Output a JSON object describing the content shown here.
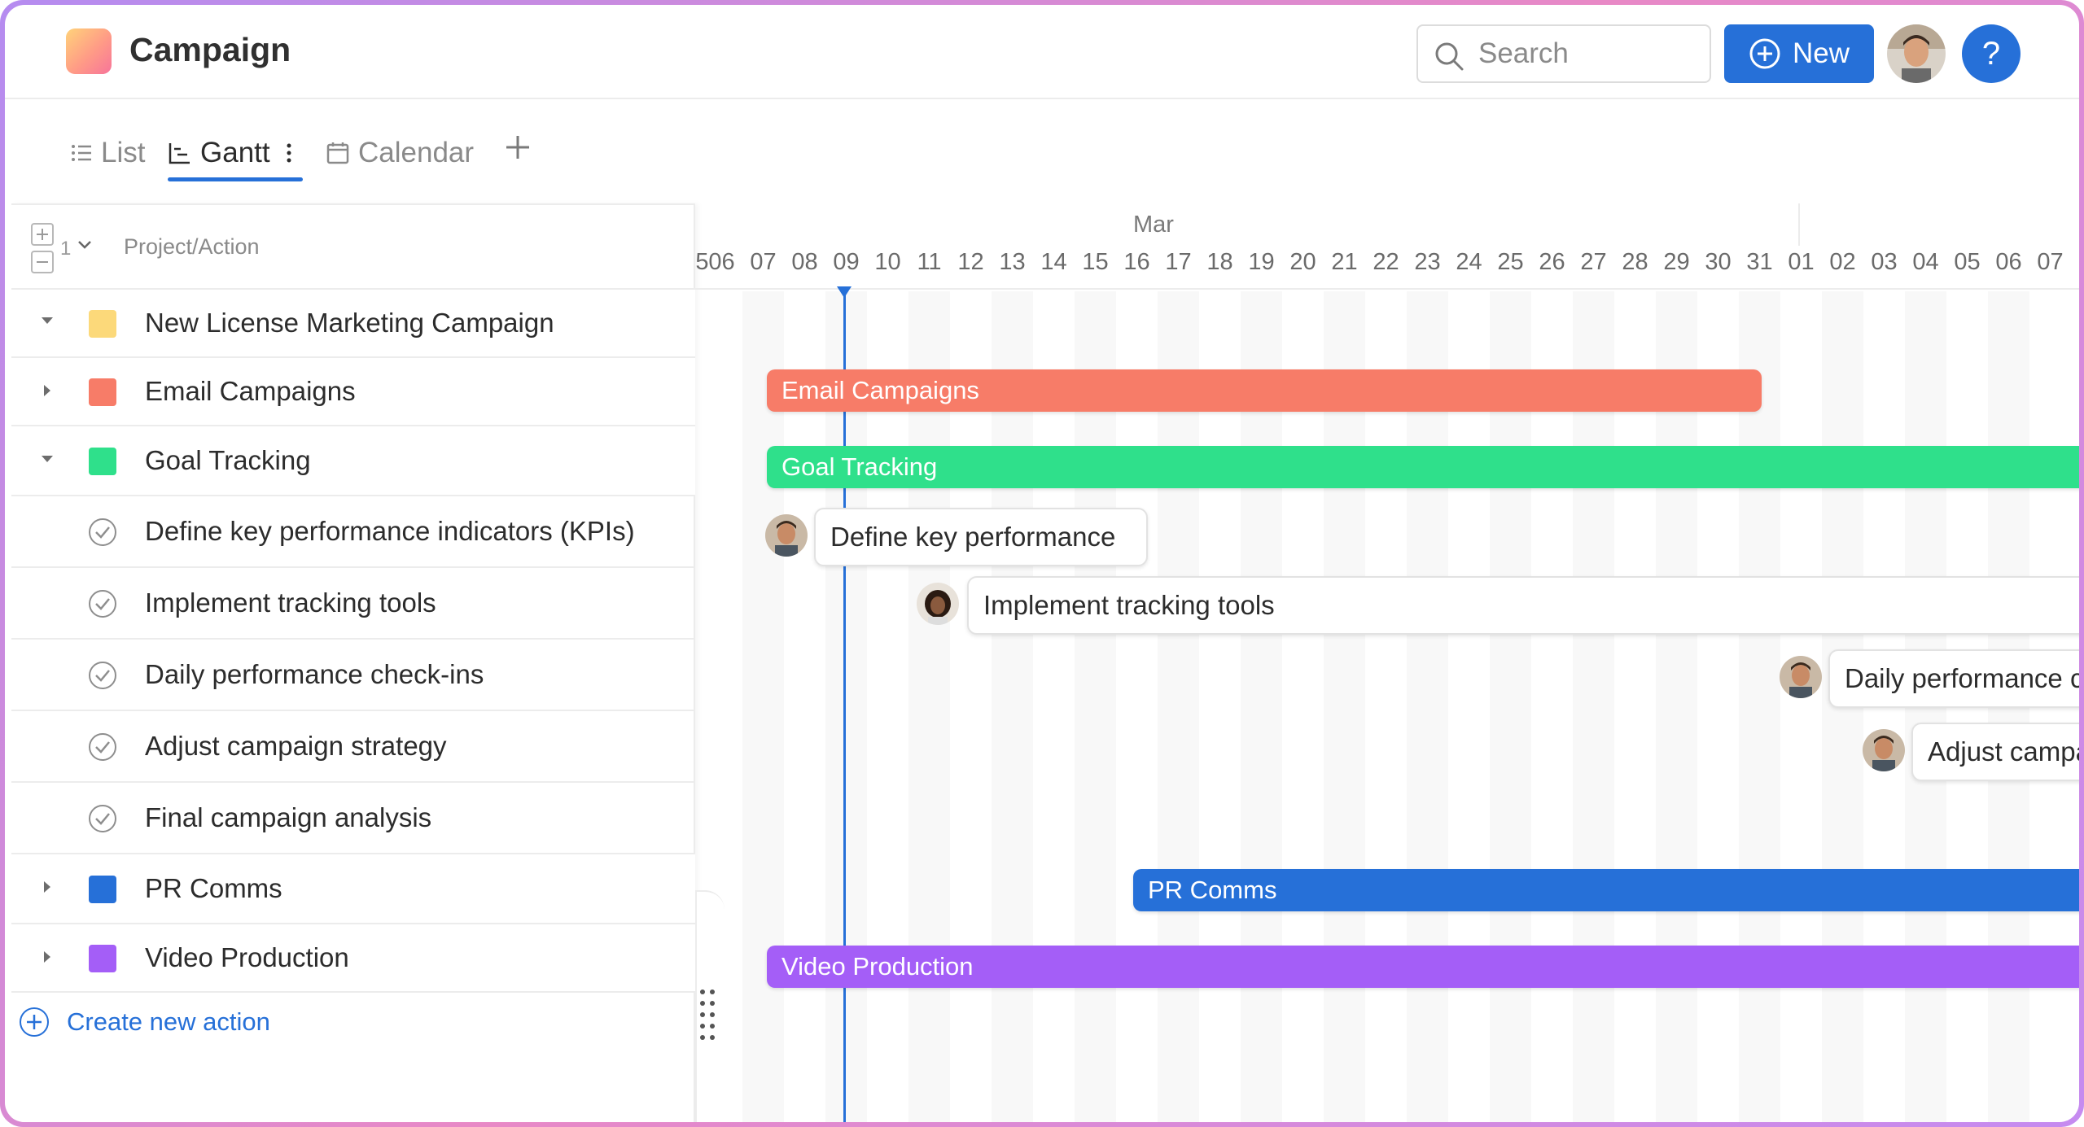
{
  "app": {
    "title": "Campaign",
    "logo_colors": [
      "#ffd37a",
      "#ff9b86",
      "#f7749a"
    ]
  },
  "header": {
    "search_placeholder": "Search",
    "new_button_label": "New",
    "help_label": "?"
  },
  "tabs": [
    {
      "label": "List",
      "icon": "list-icon",
      "active": false
    },
    {
      "label": "Gantt",
      "icon": "gantt-icon",
      "active": true
    },
    {
      "label": "Calendar",
      "icon": "calendar-icon",
      "active": false
    }
  ],
  "tree": {
    "level": "1",
    "column_label": "Project/Action",
    "rows": [
      {
        "label": "New License Marketing Campaign",
        "kind": "group",
        "expanded": true,
        "color": "#fcd97a"
      },
      {
        "label": "Email Campaigns",
        "kind": "group",
        "expanded": false,
        "color": "#f77c68"
      },
      {
        "label": "Goal Tracking",
        "kind": "group",
        "expanded": true,
        "color": "#2fe08b"
      },
      {
        "label": "Define key performance indicators (KPIs)",
        "kind": "task"
      },
      {
        "label": "Implement tracking tools",
        "kind": "task"
      },
      {
        "label": "Daily performance check-ins",
        "kind": "task"
      },
      {
        "label": "Adjust campaign strategy",
        "kind": "task"
      },
      {
        "label": "Final campaign analysis",
        "kind": "task"
      },
      {
        "label": "PR Comms",
        "kind": "group",
        "expanded": false,
        "color": "#2670d8"
      },
      {
        "label": "Video Production",
        "kind": "group",
        "expanded": false,
        "color": "#a45ef7"
      }
    ],
    "create_label": "Create new action"
  },
  "timeline": {
    "month": "Mar",
    "days": [
      "5",
      "06",
      "07",
      "08",
      "09",
      "10",
      "11",
      "12",
      "13",
      "14",
      "15",
      "16",
      "17",
      "18",
      "19",
      "20",
      "21",
      "22",
      "23",
      "24",
      "25",
      "26",
      "27",
      "28",
      "29",
      "30",
      "31",
      "01",
      "02",
      "03",
      "04",
      "05",
      "06",
      "07"
    ],
    "today": "09",
    "bars": [
      {
        "label": "Email Campaigns",
        "color": "#f77c68",
        "start": "07",
        "end": "30"
      },
      {
        "label": "Goal Tracking",
        "color": "#2fe08b",
        "start": "07",
        "end": "07 (Apr)"
      },
      {
        "label": "PR Comms",
        "color": "#2670d8",
        "start": "16",
        "end": "07 (Apr)"
      },
      {
        "label": "Video Production",
        "color": "#a45ef7",
        "start": "07",
        "end": "07 (Apr)"
      }
    ],
    "tasks": [
      {
        "label": "Define key performance",
        "start": "07"
      },
      {
        "label": "Implement tracking tools",
        "start": "11"
      },
      {
        "label": "Daily performance c",
        "start": "31"
      },
      {
        "label": "Adjust campa",
        "start": "02"
      }
    ]
  }
}
